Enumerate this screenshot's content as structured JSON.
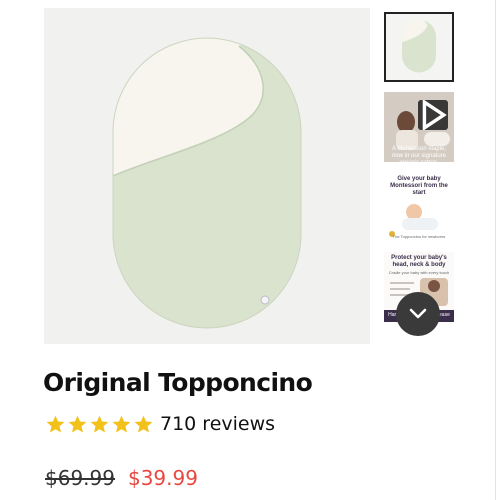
{
  "product": {
    "title": "Original Topponcino",
    "rating": 5,
    "reviews_text": "710 reviews",
    "original_price": "$69.99",
    "sale_price": "$39.99"
  },
  "gallery": {
    "thumbnails": [
      {
        "kind": "image",
        "selected": true
      },
      {
        "kind": "video",
        "caption": "A Montessori staple, now in our signature organic cotton."
      },
      {
        "kind": "image",
        "heading": "Give your baby Montessori from the start",
        "footer": "The Topponcino for newborns"
      },
      {
        "kind": "image",
        "heading": "Protect your baby's head, neck & body",
        "subheading": "Cradle your baby with every touch",
        "footer": "Handle your baby with ease & comfort"
      }
    ],
    "icons": {
      "play": "play-icon",
      "scroll": "chevron-down-icon",
      "star": "star-icon"
    }
  },
  "colors": {
    "sage": "#d9e3ce",
    "cream": "#f7f5ee",
    "star": "#f2c21a",
    "sale": "#e8483f"
  }
}
